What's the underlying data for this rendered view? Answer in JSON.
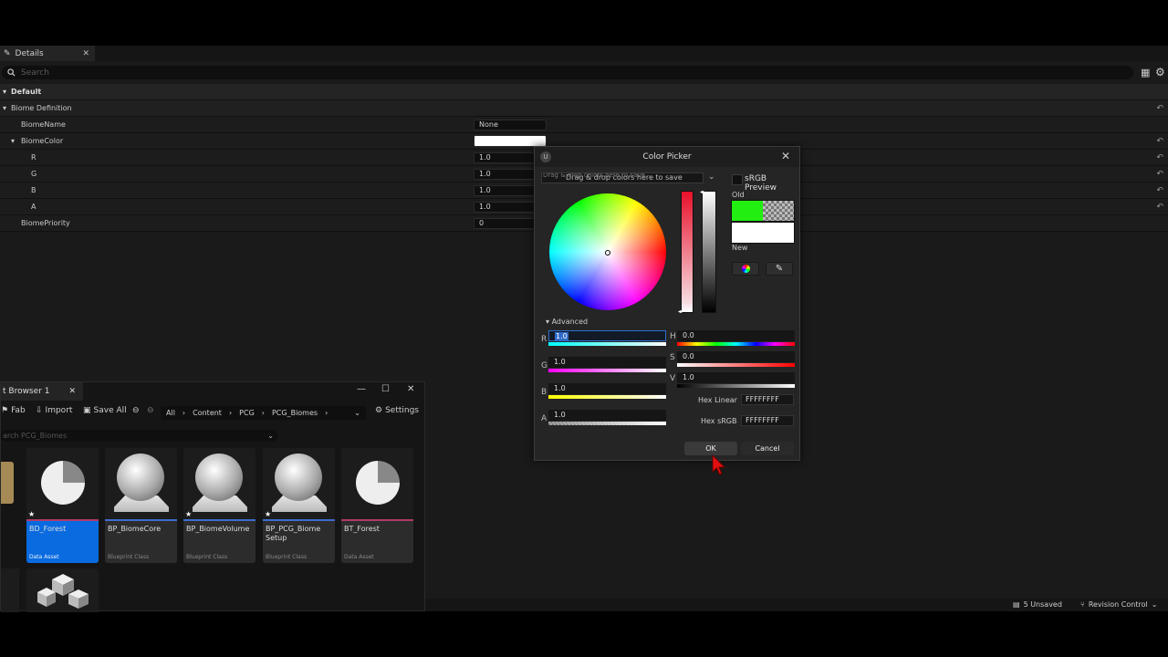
{
  "details": {
    "tab_label": "Details",
    "search_placeholder": "Search",
    "category": "Default",
    "group": "Biome Definition",
    "rows": {
      "biome_name": {
        "label": "BiomeName",
        "value": "None"
      },
      "biome_color": {
        "label": "BiomeColor"
      },
      "r": {
        "label": "R",
        "value": "1.0"
      },
      "g": {
        "label": "G",
        "value": "1.0"
      },
      "b": {
        "label": "B",
        "value": "1.0"
      },
      "a": {
        "label": "A",
        "value": "1.0"
      },
      "biome_priority": {
        "label": "BiomePriority",
        "value": "0"
      }
    }
  },
  "picker": {
    "title": "Color Picker",
    "theme_bar_text": "Drag & drop colors here to save",
    "theme_bar_hint": "Drag & drop colors here to save",
    "srgb_label": "sRGB Preview",
    "old_label": "Old",
    "new_label": "New",
    "advanced_label": "Advanced",
    "old_color": "#22ee11",
    "new_color": "#ffffff",
    "channels": {
      "r": {
        "label": "R",
        "value": "1.0"
      },
      "g": {
        "label": "G",
        "value": "1.0"
      },
      "b": {
        "label": "B",
        "value": "1.0"
      },
      "a": {
        "label": "A",
        "value": "1.0"
      },
      "h": {
        "label": "H",
        "value": "0.0"
      },
      "s": {
        "label": "S",
        "value": "0.0"
      },
      "v": {
        "label": "V",
        "value": "1.0"
      }
    },
    "hex_linear": {
      "label": "Hex Linear",
      "value": "FFFFFFFF"
    },
    "hex_srgb": {
      "label": "Hex sRGB",
      "value": "FFFFFFFF"
    },
    "ok_label": "OK",
    "cancel_label": "Cancel"
  },
  "content_browser": {
    "tab_label": "t Browser 1",
    "toolbar": {
      "fab": "Fab",
      "import": "Import",
      "save_all": "Save All",
      "settings": "Settings"
    },
    "breadcrumbs": [
      "All",
      "Content",
      "PCG",
      "PCG_Biomes"
    ],
    "search_placeholder": "arch PCG_Biomes",
    "assets": [
      {
        "name": "BD_Forest",
        "type": "Data Asset",
        "color": "#b03a6a"
      },
      {
        "name": "BP_BiomeCore",
        "type": "Blueprint Class",
        "color": "#3d6ccf"
      },
      {
        "name": "BP_BiomeVolume",
        "type": "Blueprint Class",
        "color": "#3d6ccf"
      },
      {
        "name": "BP_PCG_Biome Setup",
        "type": "Blueprint Class",
        "color": "#3d6ccf"
      },
      {
        "name": "BT_Forest",
        "type": "Data Asset",
        "color": "#b03a6a"
      }
    ]
  },
  "status": {
    "unsaved": "5 Unsaved",
    "revision_control": "Revision Control"
  }
}
